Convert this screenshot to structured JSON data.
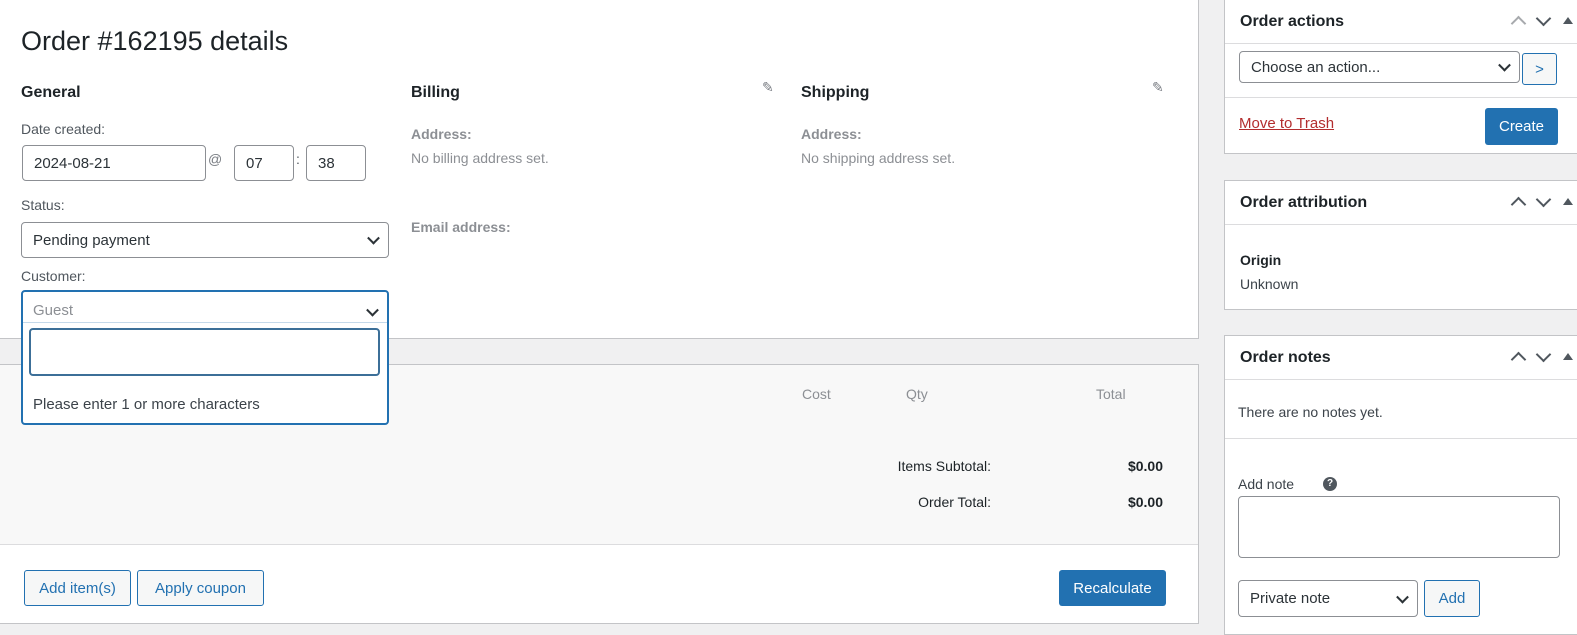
{
  "title": "Order #162195 details",
  "general": {
    "heading": "General",
    "date_label": "Date created:",
    "date": "2024-08-21",
    "at": "@",
    "hour": "07",
    "colon": ":",
    "minute": "38",
    "status_label": "Status:",
    "status": "Pending payment",
    "customer_label": "Customer:",
    "customer_placeholder": "Guest",
    "search_value": "",
    "search_hint": "Please enter 1 or more characters"
  },
  "billing": {
    "heading": "Billing",
    "address_label": "Address:",
    "address": "No billing address set.",
    "email_label": "Email address:"
  },
  "shipping": {
    "heading": "Shipping",
    "address_label": "Address:",
    "address": "No shipping address set."
  },
  "items": {
    "columns": [
      "Cost",
      "Qty",
      "Total"
    ],
    "subtotal_label": "Items Subtotal:",
    "subtotal": "$0.00",
    "total_label": "Order Total:",
    "total": "$0.00",
    "add_items": "Add item(s)",
    "apply_coupon": "Apply coupon",
    "recalculate": "Recalculate"
  },
  "order_actions": {
    "title": "Order actions",
    "select": "Choose an action...",
    "go": ">",
    "trash": "Move to Trash",
    "create": "Create"
  },
  "attribution": {
    "title": "Order attribution",
    "origin_label": "Origin",
    "origin": "Unknown"
  },
  "notes": {
    "title": "Order notes",
    "empty": "There are no notes yet.",
    "add_label": "Add note",
    "help": "?",
    "note_type": "Private note",
    "add": "Add"
  },
  "colors": {
    "primary": "#2271b1",
    "trash": "#b32d2e"
  }
}
